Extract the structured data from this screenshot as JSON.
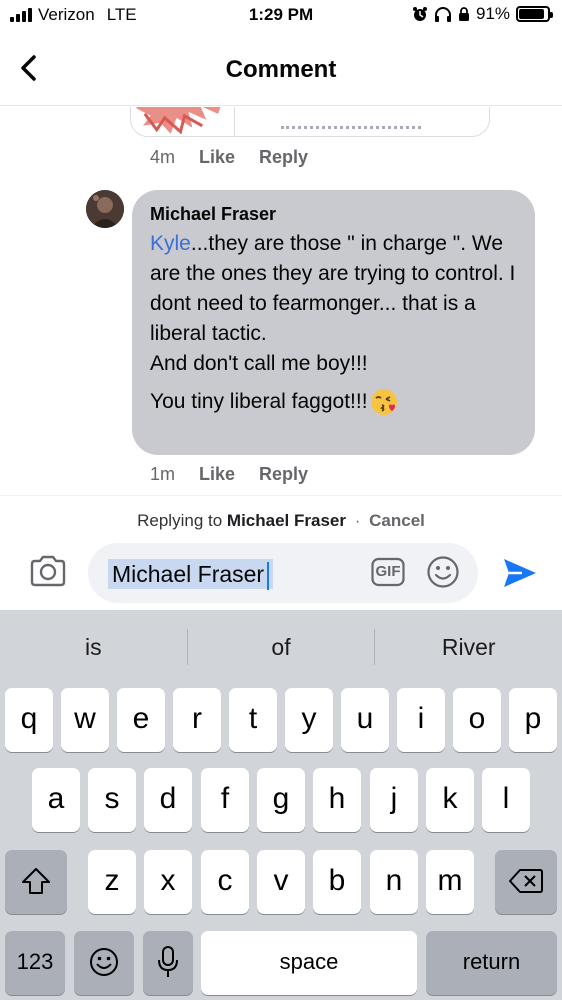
{
  "status_bar": {
    "carrier": "Verizon",
    "network": "LTE",
    "time": "1:29 PM",
    "battery_percent": "91%",
    "battery_level": 0.91
  },
  "header": {
    "title": "Comment"
  },
  "previous_comment": {
    "time": "4m",
    "like_label": "Like",
    "reply_label": "Reply"
  },
  "comment": {
    "author": "Michael Fraser",
    "mention": "Kyle",
    "text_after_mention": "...they are those \" in charge \". We are the ones they are trying to control. I dont need to fearmonger... that is a liberal tactic.",
    "line2": "And don't call me boy!!!",
    "line3": "You tiny liberal faggot!!!",
    "time": "1m",
    "like_label": "Like",
    "reply_label": "Reply"
  },
  "replying": {
    "prefix": "Replying to",
    "name": "Michael Fraser",
    "separator": "·",
    "cancel_label": "Cancel"
  },
  "composer": {
    "value": "Michael Fraser",
    "gif_label": "GIF"
  },
  "keyboard": {
    "suggestions": [
      "is",
      "of",
      "River"
    ],
    "row1": [
      "q",
      "w",
      "e",
      "r",
      "t",
      "y",
      "u",
      "i",
      "o",
      "p"
    ],
    "row2": [
      "a",
      "s",
      "d",
      "f",
      "g",
      "h",
      "j",
      "k",
      "l"
    ],
    "row3": [
      "z",
      "x",
      "c",
      "v",
      "b",
      "n",
      "m"
    ],
    "numbers_label": "123",
    "space_label": "space",
    "return_label": "return"
  },
  "colors": {
    "accent": "#1877f2",
    "mention": "#3b6fd6",
    "bubble": "#c9cacf",
    "keyboard_bg": "#d1d4d9"
  }
}
